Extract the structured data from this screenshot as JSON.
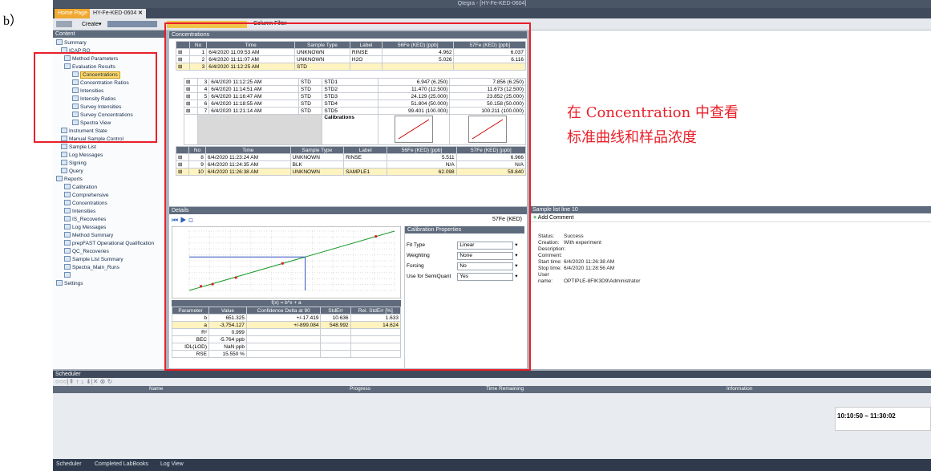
{
  "label_b": "b）",
  "window": {
    "title": "Qtegra - [HY-Fe-KED-0604]"
  },
  "tabs": {
    "home": "Home Page",
    "doc": "HY-Fe-KED-0604",
    "close": "✕"
  },
  "toolbar": {
    "create": "Create▾",
    "column_filter": "Column Filter"
  },
  "left": {
    "header": "Content",
    "items": [
      "Summary",
      "ICAP RQ",
      "Method Parameters",
      "Evaluation Results",
      "Concentrations",
      "Concentration Ratios",
      "Intensities",
      "Intensity Ratios",
      "Survey Intensities",
      "Survey Concentrations",
      "Spectra View",
      "Instrument State",
      "Manual Sample Control",
      "Sample List",
      "Log Messages",
      "Signing",
      "Query",
      "Reports",
      "Calibration",
      "Comprehensive",
      "Concentrations",
      "Intensities",
      "IS_Recoveries",
      "Log Messages",
      "Method Summary",
      "prepFAST Operational Qualification",
      "QC_Recoveries",
      "Sample List Summary",
      "Spectra_Main_Runs",
      "",
      "Settings"
    ]
  },
  "conc": {
    "header": "Concentrations",
    "cols": [
      "No",
      "Time",
      "Sample Type",
      "Label",
      "56Fe (KED) [ppb]",
      "57Fe (KED) [ppb]"
    ],
    "rows1": [
      [
        "1",
        "6/4/2020 11:09:53 AM",
        "UNKNOWN",
        "RINSE",
        "4.962",
        "6.037"
      ],
      [
        "2",
        "6/4/2020 11:11:07 AM",
        "UNKNOWN",
        "H2O",
        "5.026",
        "6.116"
      ],
      [
        "3",
        "6/4/2020 11:12:25 AM",
        "STD",
        "",
        "",
        ""
      ]
    ],
    "rows2": [
      [
        "3",
        "6/4/2020 11:12:25 AM",
        "STD",
        "STD1",
        "6.947 (6.250)",
        "7.856 (6.250)"
      ],
      [
        "4",
        "6/4/2020 11:14:51 AM",
        "STD",
        "STD2",
        "11.470 (12.500)",
        "11.673 (12.500)"
      ],
      [
        "5",
        "6/4/2020 11:16:47 AM",
        "STD",
        "STD3",
        "24.129 (25.000)",
        "23.852 (25.000)"
      ],
      [
        "6",
        "6/4/2020 11:18:55 AM",
        "STD",
        "STD4",
        "51.804 (50.000)",
        "50.158 (50.000)"
      ],
      [
        "7",
        "6/4/2020 11:21:14 AM",
        "STD",
        "STD5",
        "99.401 (100.000)",
        "100.211 (100.000)"
      ]
    ],
    "calibrations": "Calibrations",
    "rows3": [
      [
        "8",
        "6/4/2020 11:23:24 AM",
        "UNKNOWN",
        "RINSE",
        "5.511",
        "6.966"
      ],
      [
        "9",
        "6/4/2020 11:24:35 AM",
        "BLK",
        "",
        "N/A",
        "N/A"
      ],
      [
        "10",
        "6/4/2020 11:26:38 AM",
        "UNKNOWN",
        "SAMPLE1",
        "62.098",
        "59.840"
      ]
    ]
  },
  "details": {
    "header": "Details",
    "isotope": "57Fe (KED)",
    "formula": "f(x) = b*x + a",
    "param_cols": [
      "Parameter",
      "Value",
      "Confidence Delta at 90",
      "StdErr",
      "Rel. StdErr [%]"
    ],
    "params": [
      [
        "b",
        "651.325",
        "+/-17.419",
        "10.636",
        "1.633"
      ],
      [
        "a",
        "-3,754.127",
        "+/-899.084",
        "548.992",
        "14.624"
      ],
      [
        "R²",
        "0.999",
        "",
        "",
        ""
      ],
      [
        "BEC",
        "-5.764 ppb",
        "",
        "",
        ""
      ],
      [
        "IDL(LOD)",
        "NaN ppb",
        "",
        "",
        ""
      ],
      [
        "RSE",
        "15.550 %",
        "",
        "",
        ""
      ]
    ],
    "cp_header": "Calibration Properties",
    "cp": [
      [
        "Fit Type",
        "Linear"
      ],
      [
        "Weighting",
        "None"
      ],
      [
        "Forcing",
        "No"
      ],
      [
        "Use for SemiQuant",
        "Yes"
      ]
    ]
  },
  "sample_info": {
    "header": "Sample list line 10",
    "add_comment": "Add Comment",
    "lines": [
      [
        "Status:",
        "Success"
      ],
      [
        "Creation:",
        "With experiment"
      ],
      [
        "Description:",
        ""
      ],
      [
        "Comment:",
        ""
      ],
      [
        "Start time:",
        "6/4/2020 11:26:38 AM"
      ],
      [
        "Stop time:",
        "6/4/2020 11:28:56 AM"
      ],
      [
        "User name:",
        "OPTIPLE-8FIK3D9\\Administrator"
      ]
    ]
  },
  "scheduler": {
    "header": "Scheduler",
    "cols": [
      "Name",
      "Progress",
      "Time Remaining",
      "Information"
    ]
  },
  "notify": {
    "text": "",
    "time": "10:10:50 ~ 11:30:02"
  },
  "taskbar": {
    "items": [
      "Scheduler",
      "Completed LabBooks",
      "Log View"
    ]
  },
  "annotation": {
    "line1": "在 Concentration 中查看",
    "line2": "标准曲线和样品浓度"
  },
  "chart_data": {
    "type": "scatter",
    "title": "",
    "series": [
      {
        "name": "points",
        "x": [
          6.25,
          12.5,
          25,
          50,
          100
        ],
        "y": [
          7.856,
          11.673,
          23.852,
          50.158,
          100.211
        ]
      }
    ],
    "fit": {
      "b": 651.325,
      "a": -3754.127
    },
    "marker": {
      "x": 62.098
    }
  }
}
